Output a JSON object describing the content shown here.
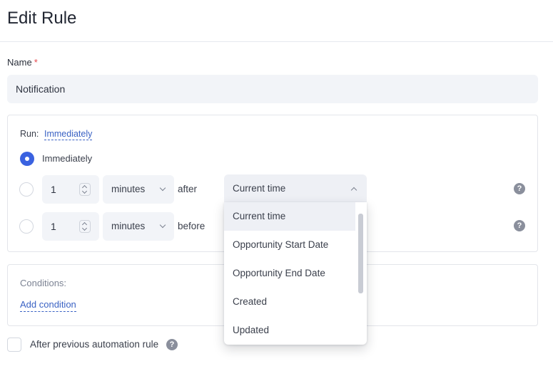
{
  "header": {
    "title": "Edit Rule"
  },
  "name_field": {
    "label": "Name",
    "required_mark": "*",
    "value": "Notification"
  },
  "run": {
    "label": "Run:",
    "value": "Immediately",
    "options": [
      {
        "label": "Immediately",
        "checked": true
      },
      {
        "number": "1",
        "unit": "minutes",
        "relation": "after",
        "reference": "Current time",
        "checked": false
      },
      {
        "number": "1",
        "unit": "minutes",
        "relation": "before",
        "checked": false
      }
    ],
    "help_icon": "?"
  },
  "dropdown": {
    "items": [
      "Current time",
      "Opportunity Start Date",
      "Opportunity End Date",
      "Created",
      "Updated"
    ],
    "active_index": 0
  },
  "conditions": {
    "label": "Conditions:",
    "add_link": "Add condition"
  },
  "after_previous": {
    "label": "After previous automation rule",
    "checked": false
  },
  "colors": {
    "accent": "#3a62e0",
    "link": "#3a62c4",
    "field_bg": "#f2f4f8",
    "required": "#e5484d"
  }
}
